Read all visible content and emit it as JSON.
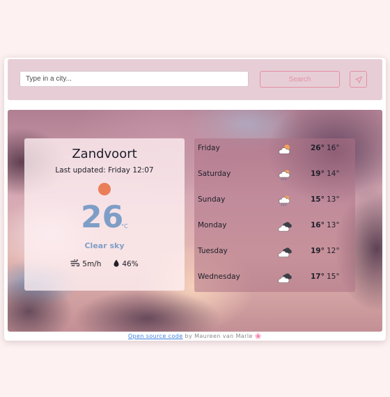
{
  "search": {
    "placeholder": "Type in a city...",
    "button_label": "Search",
    "location_icon": "location-arrow-icon"
  },
  "current": {
    "city": "Zandvoort",
    "updated": "Last updated: Friday 12:07",
    "icon": "sun-icon",
    "temperature": "26",
    "unit": "°C",
    "description": "Clear sky",
    "wind": "5m/h",
    "humidity": "46%",
    "wind_icon": "wind-icon",
    "humidity_icon": "droplet-icon",
    "sun_color": "#e97e59",
    "accent_color": "#7e9ec7"
  },
  "forecast": [
    {
      "day": "Friday",
      "max": "26°",
      "min": "16°",
      "icon": "sun-behind-cloud-icon"
    },
    {
      "day": "Saturday",
      "max": "19°",
      "min": "14°",
      "icon": "sun-cloud-rain-icon"
    },
    {
      "day": "Sunday",
      "max": "15°",
      "min": "13°",
      "icon": "sun-cloud-rain-icon"
    },
    {
      "day": "Monday",
      "max": "16°",
      "min": "13°",
      "icon": "dark-clouds-icon"
    },
    {
      "day": "Tuesday",
      "max": "19°",
      "min": "12°",
      "icon": "dark-clouds-icon"
    },
    {
      "day": "Wednesday",
      "max": "17°",
      "min": "15°",
      "icon": "dark-clouds-icon"
    }
  ],
  "footer": {
    "link": "Open source code",
    "by": " by Maureen van Marle ",
    "flower": "🌸"
  },
  "colors": {
    "page_bg": "#fdf1f1",
    "searchbar_bg": "#e7ced6",
    "button_accent": "#e48fa4"
  }
}
